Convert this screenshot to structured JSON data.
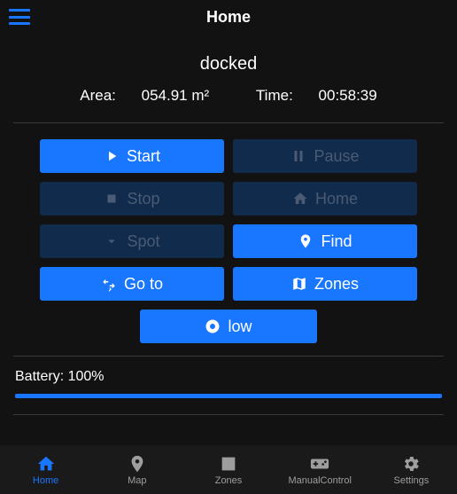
{
  "header": {
    "title": "Home"
  },
  "status": "docked",
  "stats": {
    "area_label": "Area:",
    "area_value": "054.91 m²",
    "time_label": "Time:",
    "time_value": "00:58:39"
  },
  "buttons": {
    "start": "Start",
    "pause": "Pause",
    "stop": "Stop",
    "home": "Home",
    "spot": "Spot",
    "find": "Find",
    "goto": "Go to",
    "zones": "Zones",
    "fanspeed": "low"
  },
  "battery": {
    "label": "Battery:",
    "value": "100%",
    "percent": 100
  },
  "tabs": {
    "home": "Home",
    "map": "Map",
    "zones": "Zones",
    "manual": "ManualControl",
    "settings": "Settings"
  }
}
